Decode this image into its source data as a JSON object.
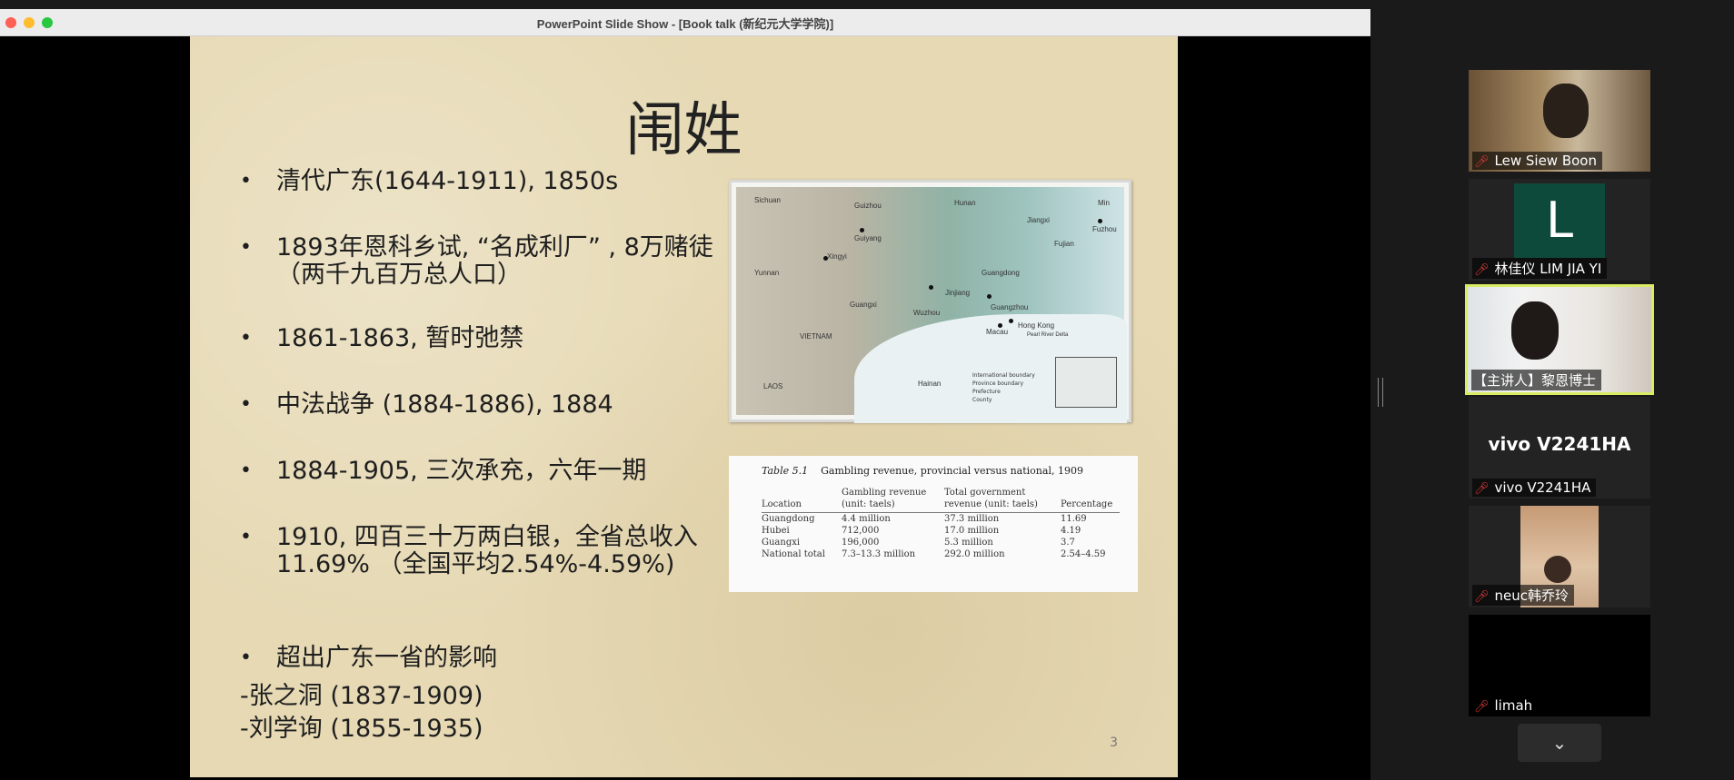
{
  "window": {
    "title": "PowerPoint Slide Show - [Book talk (新纪元大学学院)]"
  },
  "slide": {
    "title": "闱姓",
    "bullets": [
      "清代广东(1644-1911), 1850s",
      "1893年恩科乡试, “名成利厂” , 8万赌徒（两千九百万总人口）",
      "1861-1863, 暂时弛禁",
      "中法战争 (1884-1886), 1884",
      "1884-1905, 三次承充，六年一期",
      "1910, 四百三十万两白银，全省总收入 11.69% （全国平均2.54%-4.59%)",
      "超出广东一省的影响"
    ],
    "sub_lines": [
      "-张之洞 (1837-1909)",
      "-刘学询 (1855-1935)"
    ],
    "page_number": "3",
    "map": {
      "labels": [
        "Sichuan",
        "Guizhou",
        "Hunan",
        "Jiangxi",
        "Min",
        "Fuzhou",
        "Guiyang",
        "Fujian",
        "Yunnan",
        "Xingyi",
        "Guangdong",
        "Jinjiang",
        "Guangxi",
        "Wuzhou",
        "Guangzhou",
        "Hong Kong",
        "Macau",
        "VIETNAM",
        "Pearl River Delta",
        "Hainan",
        "LAOS"
      ],
      "legend": [
        "International boundary",
        "Province boundary",
        "Prefecture",
        "County"
      ]
    },
    "table": {
      "caption_num": "Table 5.1",
      "caption_text": "Gambling revenue, provincial versus national, 1909",
      "headers": [
        "Location",
        "Gambling revenue (unit: taels)",
        "Total government revenue (unit: taels)",
        "Percentage"
      ],
      "rows": [
        [
          "Guangdong",
          "4.4 million",
          "37.3 million",
          "11.69"
        ],
        [
          "Hubei",
          "712,000",
          "17.0 million",
          "4.19"
        ],
        [
          "Guangxi",
          "196,000",
          "5.3 million",
          "3.7"
        ],
        [
          "National total",
          "7.3–13.3 million",
          "292.0 million",
          "2.54–4.59"
        ]
      ]
    }
  },
  "participants": [
    {
      "name": "Lew Siew Boon",
      "muted": true
    },
    {
      "name": "林佳仪 LIM JIA YI",
      "muted": true,
      "initial": "L"
    },
    {
      "name": "【主讲人】黎恩博士",
      "muted": false,
      "active_speaker": true
    },
    {
      "name": "vivo V2241HA",
      "muted": true,
      "device_label": "vivo V2241HA"
    },
    {
      "name": "neuc韩乔玲",
      "muted": true
    },
    {
      "name": "limah",
      "muted": true
    }
  ],
  "icons": {
    "mic_muted": "mic-muted-icon",
    "chevron": "chevron-down-icon"
  },
  "colors": {
    "active_speaker_border": "#d9ec63",
    "avatar_bg": "#0e4a3c",
    "mic_muted": "#e23b3b"
  }
}
